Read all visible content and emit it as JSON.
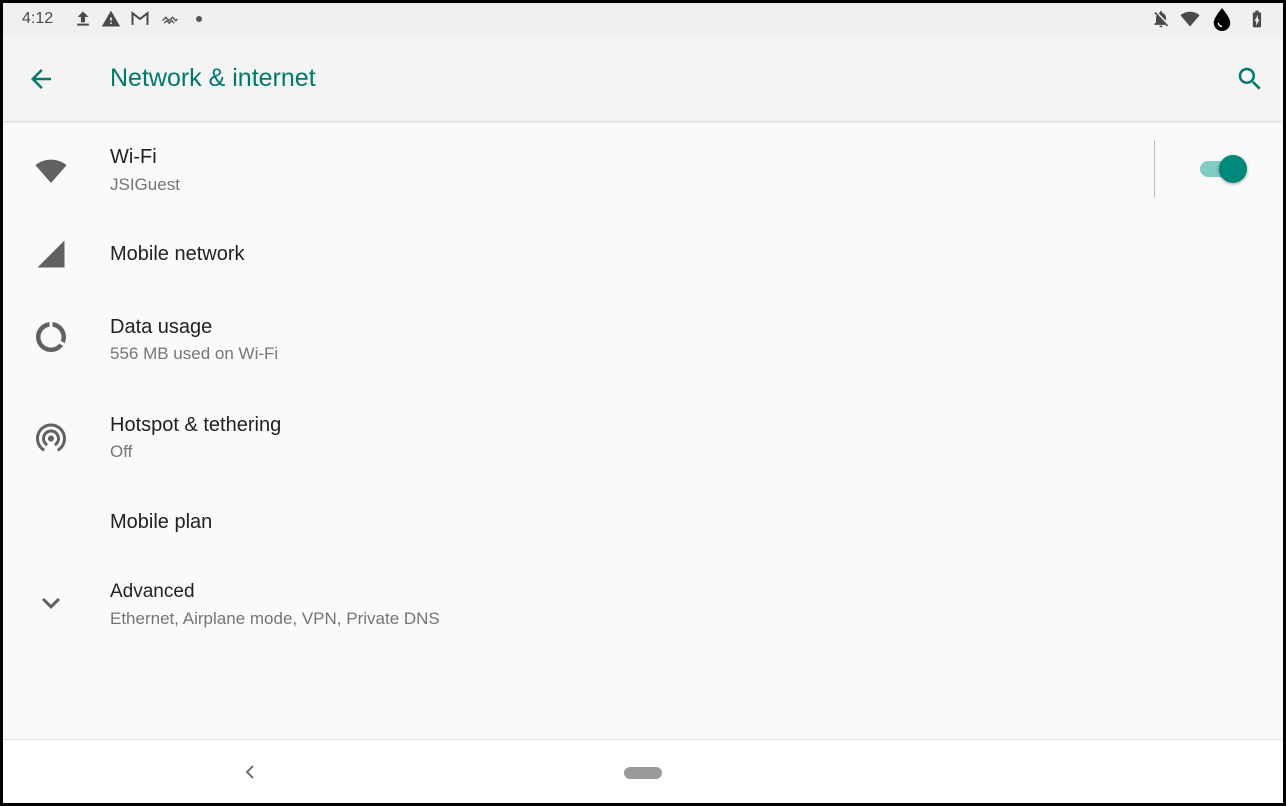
{
  "status_bar": {
    "time": "4:12",
    "left_icons": [
      "upload-icon",
      "warning-icon",
      "gmail-icon",
      "sync-icon",
      "notification-dot"
    ],
    "right_icons": [
      "notifications-off-icon",
      "wifi-signal-icon",
      "drop-icon",
      "battery-icon"
    ]
  },
  "app_bar": {
    "title": "Network & internet",
    "back_icon": "arrow-back-icon",
    "search_icon": "search-icon"
  },
  "settings": [
    {
      "title": "Wi-Fi",
      "subtitle": "JSIGuest",
      "icon": "wifi-icon"
    },
    {
      "title": "Mobile network",
      "icon": "signal-icon"
    },
    {
      "title": "Data usage",
      "subtitle": "556 MB used on Wi-Fi",
      "icon": "data-usage-icon"
    },
    {
      "title": "Hotspot & tethering",
      "subtitle": "Off",
      "icon": "hotspot-icon"
    },
    {
      "title": "Mobile plan"
    },
    {
      "title": "Advanced",
      "subtitle": "Ethernet, Airplane mode, VPN, Private DNS",
      "icon": "chevron-down-icon"
    }
  ],
  "wifi_toggle": {
    "state": "on"
  },
  "colors": {
    "accent": "#00796b",
    "toggle_thumb": "#00897b",
    "toggle_track": "#80cbc4"
  },
  "nav_bar": {
    "back_icon": "nav-back-icon",
    "home_icon": "home-pill-icon"
  }
}
